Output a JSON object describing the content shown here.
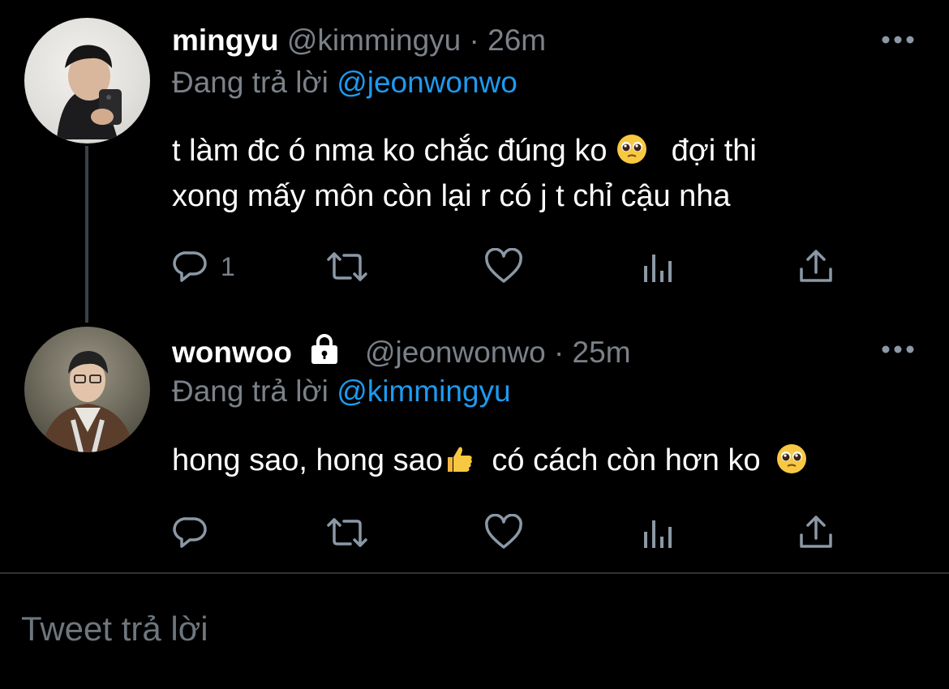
{
  "tweets": [
    {
      "name": "mingyu",
      "handle": "@kimmingyu",
      "separator": "·",
      "time": "26m",
      "replying_prefix": "Đang trả lời",
      "replying_to": "@jeonwonwo",
      "text_line1_a": "t làm đc ó nma ko chắc đúng ko",
      "text_line1_b": "đợi thi",
      "text_line2": "xong mấy môn còn lại r có j t chỉ cậu nha",
      "reply_count": "1",
      "avatar_icon": "user-avatar-photo"
    },
    {
      "name": "wonwoo",
      "handle": "@jeonwonwo",
      "separator": "·",
      "time": "25m",
      "replying_prefix": "Đang trả lời",
      "replying_to": "@kimmingyu",
      "text_a": "hong sao, hong sao",
      "text_b": "có cách còn hơn ko",
      "protected": true,
      "avatar_icon": "user-avatar-photo"
    }
  ],
  "icons": {
    "reply": "reply-icon",
    "retweet": "retweet-icon",
    "like": "heart-icon",
    "analytics": "analytics-icon",
    "share": "share-icon",
    "more": "more-icon",
    "lock": "lock-icon",
    "emoji_pleading": "pleading-face-emoji",
    "emoji_thumbs": "thumbs-up-emoji"
  },
  "reply_box": {
    "placeholder": "Tweet trả lời"
  },
  "colors": {
    "background": "#000000",
    "mention": "#1d9bf0",
    "muted": "#7b8188",
    "icon": "#8b98a5"
  }
}
